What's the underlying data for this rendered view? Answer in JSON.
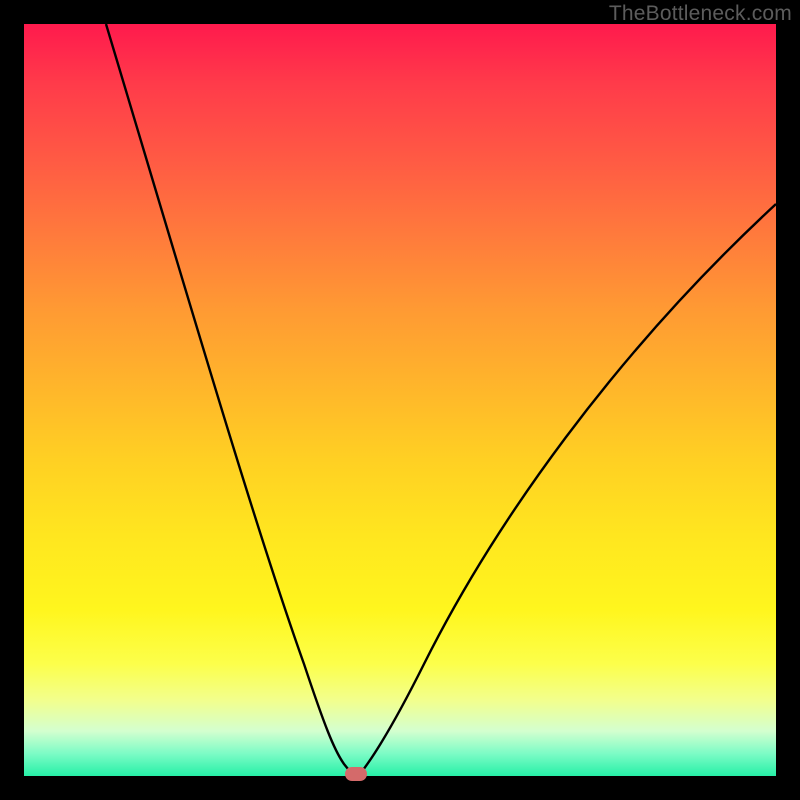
{
  "watermark": "TheBottleneck.com",
  "chart_data": {
    "type": "line",
    "title": "",
    "xlabel": "",
    "ylabel": "",
    "xlim": [
      0,
      100
    ],
    "ylim": [
      0,
      100
    ],
    "grid": false,
    "legend": false,
    "annotations": [
      {
        "name": "optimal-point",
        "x": 42,
        "y": 0
      }
    ],
    "background_gradient": {
      "direction": "vertical",
      "stops": [
        {
          "pos": 0.0,
          "color": "#ff1a4d"
        },
        {
          "pos": 0.5,
          "color": "#ffc226"
        },
        {
          "pos": 0.8,
          "color": "#fff61e"
        },
        {
          "pos": 1.0,
          "color": "#26f0a7"
        }
      ]
    },
    "series": [
      {
        "name": "bottleneck-curve",
        "x": [
          11,
          15,
          20,
          25,
          30,
          35,
          40,
          42,
          45,
          50,
          55,
          60,
          70,
          80,
          90,
          100
        ],
        "y": [
          100,
          87,
          72,
          57,
          42,
          28,
          10,
          0,
          5,
          18,
          32,
          44,
          60,
          70,
          77,
          80
        ]
      }
    ],
    "notes": "Axes are unlabeled in the source image; x and y expressed as 0-100 percent of plot area. Curve is a V-shaped bottleneck profile with minimum near x≈42%."
  }
}
